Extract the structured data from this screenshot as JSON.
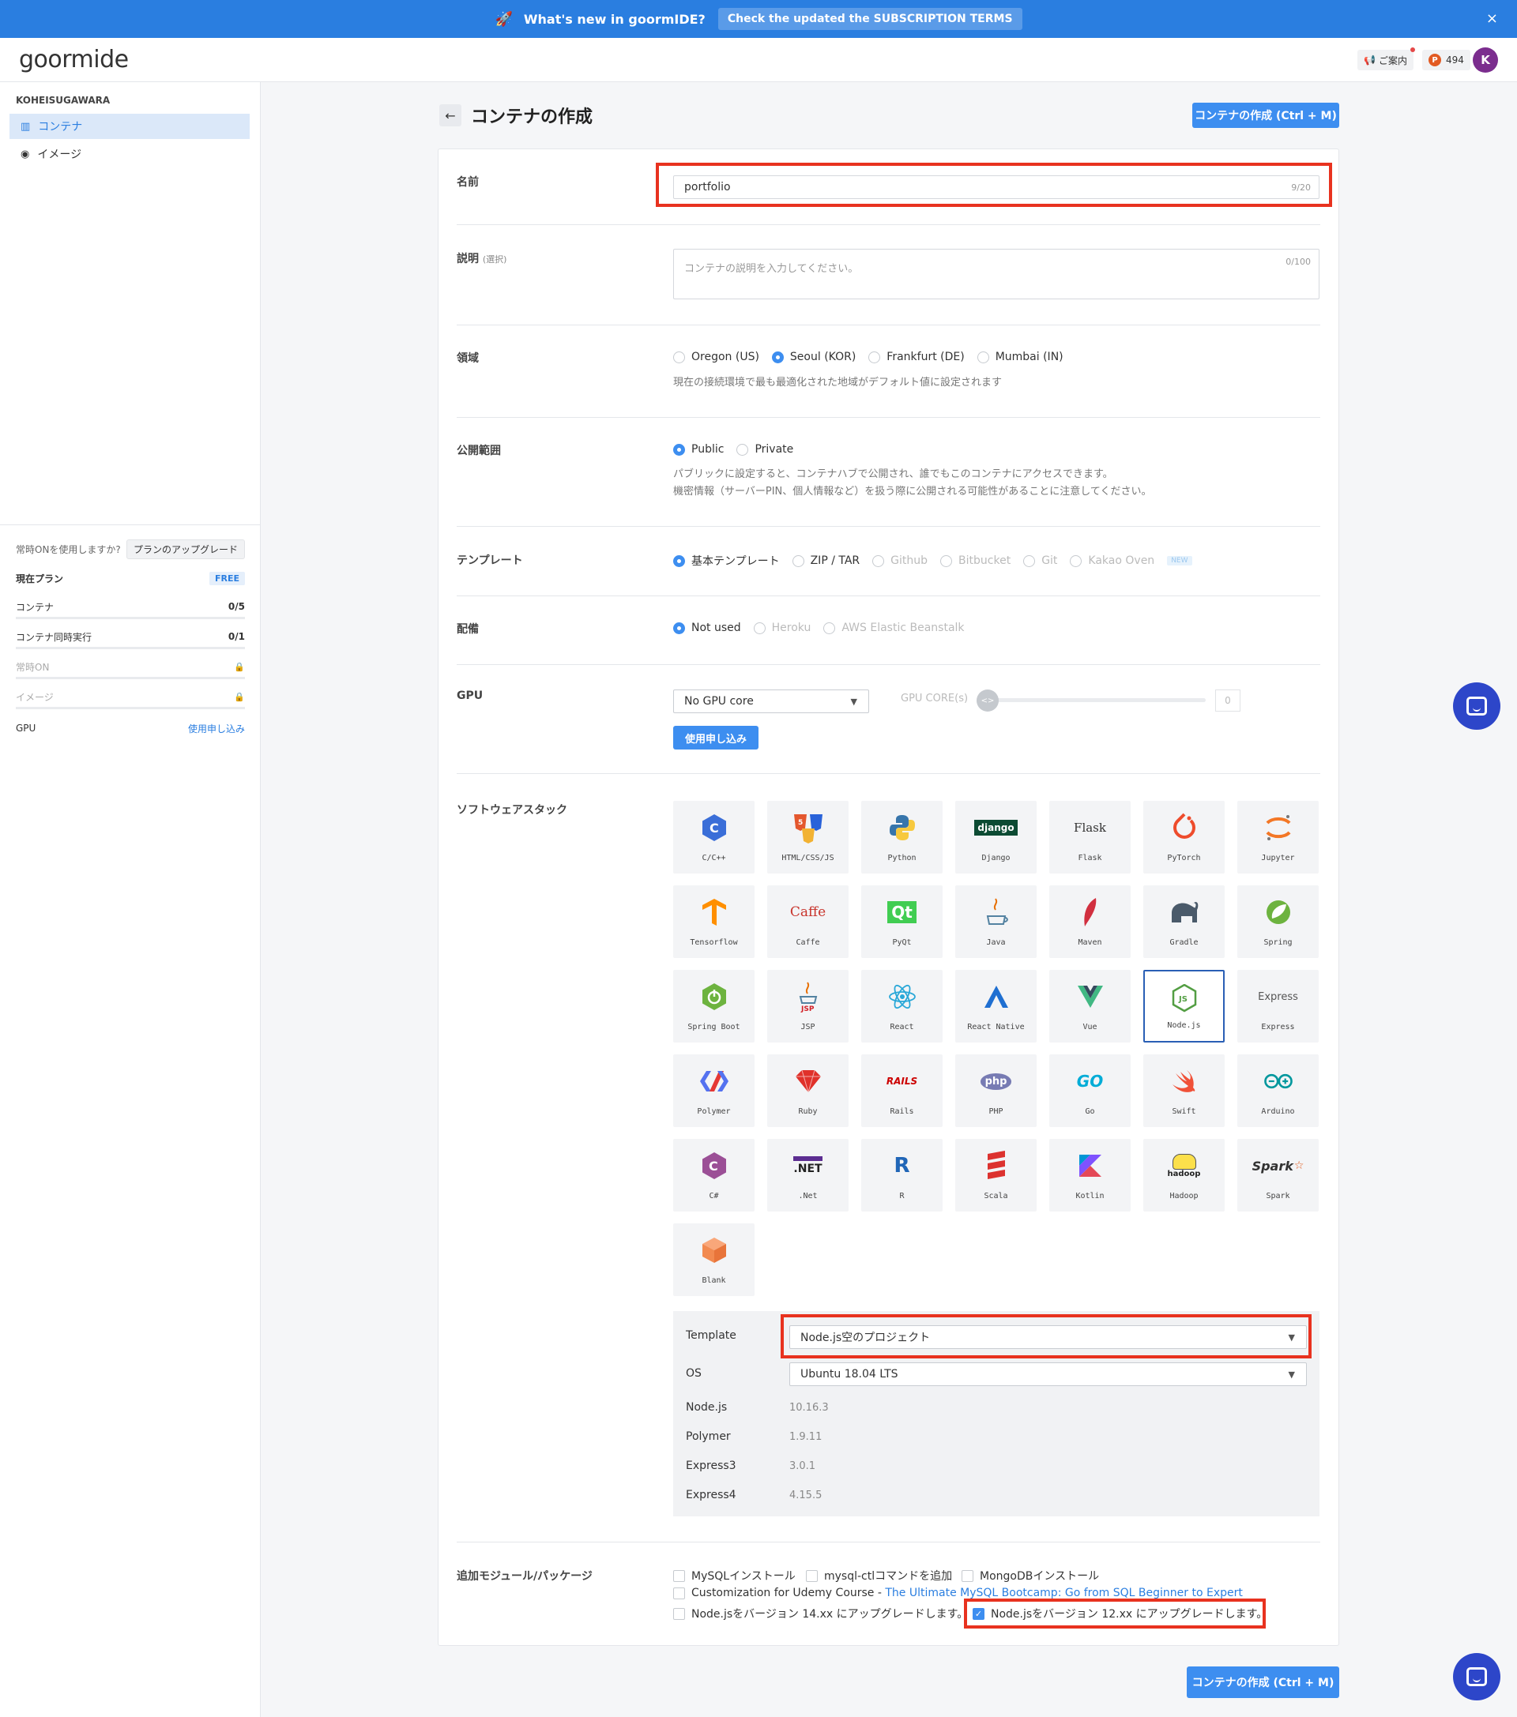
{
  "banner": {
    "title": "What's new in goormIDE?",
    "terms": "Check the updated the SUBSCRIPTION TERMS",
    "close": "×"
  },
  "topbar": {
    "logo": "goormide",
    "notice": "ご案内",
    "points": "494",
    "points_icon": "P",
    "avatar": "K"
  },
  "sidebar": {
    "user": "KOHEISUGAWARA",
    "items": [
      {
        "label": "コンテナ",
        "icon": "grid-icon"
      },
      {
        "label": "イメージ",
        "icon": "disc-icon"
      }
    ],
    "plan_question": "常時ONを使用しますか?",
    "plan_upgrade": "プランのアップグレード",
    "current_plan": "現在プラン",
    "plan_badge": "FREE",
    "rows": [
      {
        "label": "コンテナ",
        "value": "0/5"
      },
      {
        "label": "コンテナ同時実行",
        "value": "0/1"
      },
      {
        "label": "常時ON",
        "value": ""
      },
      {
        "label": "イメージ",
        "value": ""
      },
      {
        "label": "GPU",
        "value": "使用申し込み"
      }
    ]
  },
  "page": {
    "title": "コンテナの作成",
    "create_button": "コンテナの作成 (Ctrl + M)"
  },
  "form": {
    "name": {
      "label": "名前",
      "value": "portfolio",
      "counter": "9/20"
    },
    "description": {
      "label": "説明",
      "optional": "(選択)",
      "placeholder": "コンテナの説明を入力してください。",
      "counter": "0/100"
    },
    "region": {
      "label": "領域",
      "options": [
        "Oregon (US)",
        "Seoul (KOR)",
        "Frankfurt (DE)",
        "Mumbai (IN)"
      ],
      "selected": "Seoul (KOR)",
      "help": "現在の接続環境で最も最適化された地域がデフォルト値に設定されます"
    },
    "visibility": {
      "label": "公開範囲",
      "options": [
        "Public",
        "Private"
      ],
      "selected": "Public",
      "help1": "パブリックに設定すると、コンテナハブで公開され、誰でもこのコンテナにアクセスできます。",
      "help2": "機密情報（サーバーPIN、個人情報など）を扱う際に公開される可能性があることに注意してください。"
    },
    "template": {
      "label": "テンプレート",
      "options": [
        "基本テンプレート",
        "ZIP / TAR",
        "Github",
        "Bitbucket",
        "Git",
        "Kakao Oven"
      ],
      "selected": "基本テンプレート",
      "new_badge": "NEW"
    },
    "deploy": {
      "label": "配備",
      "options": [
        "Not used",
        "Heroku",
        "AWS Elastic Beanstalk"
      ],
      "selected": "Not used"
    },
    "gpu": {
      "label": "GPU",
      "select": "No GPU core",
      "core_label": "GPU CORE(s)",
      "core_value": "0",
      "apply_button": "使用申し込み",
      "slider_glyph": "<>"
    },
    "stack": {
      "label": "ソフトウェアスタック",
      "selected": "Node.js",
      "items": [
        "C/C++",
        "HTML/CSS/JS",
        "Python",
        "Django",
        "Flask",
        "PyTorch",
        "Jupyter",
        "Tensorflow",
        "Caffe",
        "PyQt",
        "Java",
        "Maven",
        "Gradle",
        "Spring",
        "Spring Boot",
        "JSP",
        "React",
        "React Native",
        "Vue",
        "Node.js",
        "Express",
        "Polymer",
        "Ruby",
        "Rails",
        "PHP",
        "Go",
        "Swift",
        "Arduino",
        "C#",
        ".Net",
        "R",
        "Scala",
        "Kotlin",
        "Hadoop",
        "Spark",
        "Blank"
      ],
      "icon_text": {
        "cpp": "C",
        "html": "5",
        "django": "django",
        "flask": "Flask",
        "caffe": "Caffe",
        "pyqt": "Qt",
        "express": "Express",
        "rails": "RAILS",
        "php": "php",
        "go": "GO",
        "csharp": "C",
        "net": ".NET",
        "r": "R",
        "hadoop": "hadoop",
        "spark": "Spark",
        "jsp": "JSP",
        "node": "JS"
      }
    },
    "stack_config": {
      "rows": [
        {
          "label": "Template",
          "value": "Node.js空のプロジェクト"
        },
        {
          "label": "OS",
          "value": "Ubuntu 18.04 LTS"
        },
        {
          "label": "Node.js",
          "value": "10.16.3"
        },
        {
          "label": "Polymer",
          "value": "1.9.11"
        },
        {
          "label": "Express3",
          "value": "3.0.1"
        },
        {
          "label": "Express4",
          "value": "4.15.5"
        }
      ]
    },
    "modules": {
      "label": "追加モジュール/パッケージ",
      "mysql": "MySQLインストール",
      "mysqlctl": "mysql-ctlコマンドを追加",
      "mongodb": "MongoDBインストール",
      "udemy_prefix": "Customization for Udemy Course - ",
      "udemy_link": "The Ultimate MySQL Bootcamp: Go from SQL Beginner to Expert",
      "node14": "Node.jsをバージョン 14.xx にアップグレードします。",
      "node12": "Node.jsをバージョン 12.xx にアップグレードします。",
      "check": "✓"
    }
  },
  "colors": {
    "accent": "#3d8ef0",
    "banner": "#2a7ee0",
    "highlight": "#e8321f",
    "chat": "#2d46c9"
  }
}
